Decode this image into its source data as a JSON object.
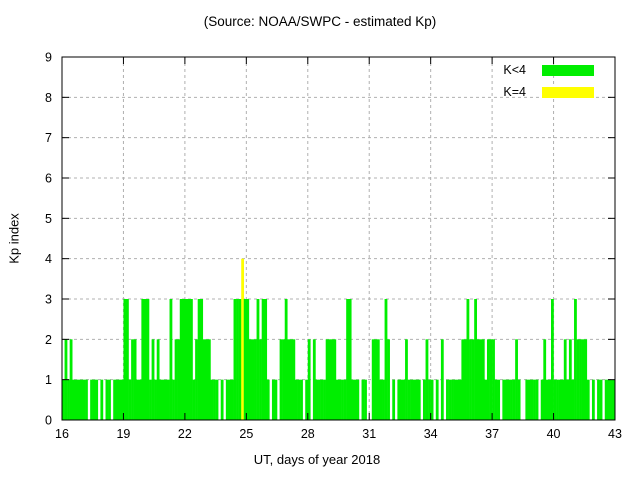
{
  "title": "(Source: NOAA/SWPC - estimated Kp)",
  "x_axis": {
    "label": "UT, days of year 2018",
    "range": [
      16,
      43
    ]
  },
  "y_axis": {
    "label": "Kp index",
    "range": [
      0,
      9
    ]
  },
  "legend": {
    "items": [
      {
        "label": "K<4",
        "color": "#00ee00"
      },
      {
        "label": "K=4",
        "color": "#ffff00"
      }
    ]
  },
  "colors": {
    "green_bar": "#00ee00",
    "yellow_bar": "#ffff00",
    "grid": "#b0b0b0",
    "axis": "#000000",
    "background": "#ffffff"
  },
  "chart_data": {
    "type": "bar",
    "title": "(Source: NOAA/SWPC - estimated Kp)",
    "xlabel": "UT, days of year 2018",
    "ylabel": "Kp index",
    "xlim": [
      16,
      43
    ],
    "ylim": [
      0,
      9
    ],
    "x_ticks": [
      16,
      19,
      22,
      25,
      28,
      31,
      34,
      37,
      40,
      43
    ],
    "y_ticks": [
      0,
      1,
      2,
      3,
      4,
      5,
      6,
      7,
      8,
      9
    ],
    "grid": true,
    "legend_position": "top-right",
    "samples_per_day": 8,
    "series": [
      {
        "name": "K<4",
        "color": "#00ee00",
        "rule": "kp<4"
      },
      {
        "name": "K=4",
        "color": "#ffff00",
        "rule": "kp=4"
      }
    ],
    "days": [
      {
        "day": 16,
        "kp": [
          1,
          2,
          1,
          2,
          1,
          1,
          1,
          1
        ]
      },
      {
        "day": 17,
        "kp": [
          1,
          1,
          0,
          1,
          1,
          1,
          0,
          1
        ]
      },
      {
        "day": 18,
        "kp": [
          0,
          1,
          1,
          0,
          1,
          1,
          1,
          1
        ]
      },
      {
        "day": 19,
        "kp": [
          3,
          3,
          1,
          2,
          2,
          1,
          1,
          3
        ]
      },
      {
        "day": 20,
        "kp": [
          3,
          3,
          1,
          2,
          1,
          2,
          1,
          1
        ]
      },
      {
        "day": 21,
        "kp": [
          1,
          1,
          3,
          1,
          2,
          2,
          3,
          3
        ]
      },
      {
        "day": 22,
        "kp": [
          3,
          3,
          3,
          1,
          2,
          3,
          3,
          2
        ]
      },
      {
        "day": 23,
        "kp": [
          2,
          2,
          1,
          1,
          1,
          0,
          1,
          0
        ]
      },
      {
        "day": 24,
        "kp": [
          1,
          1,
          1,
          3,
          3,
          3,
          4,
          3
        ]
      },
      {
        "day": 25,
        "kp": [
          3,
          2,
          2,
          2,
          3,
          2,
          3,
          3
        ]
      },
      {
        "day": 26,
        "kp": [
          1,
          0,
          1,
          1,
          0,
          2,
          2,
          3
        ]
      },
      {
        "day": 27,
        "kp": [
          2,
          2,
          2,
          1,
          1,
          1,
          0,
          1
        ]
      },
      {
        "day": 28,
        "kp": [
          2,
          0,
          2,
          1,
          1,
          1,
          1,
          2
        ]
      },
      {
        "day": 29,
        "kp": [
          2,
          2,
          2,
          1,
          1,
          1,
          1,
          3
        ]
      },
      {
        "day": 30,
        "kp": [
          3,
          1,
          1,
          1,
          0,
          1,
          1,
          0
        ]
      },
      {
        "day": 31,
        "kp": [
          0,
          2,
          2,
          2,
          1,
          1,
          3,
          2
        ]
      },
      {
        "day": 32,
        "kp": [
          0,
          1,
          0,
          1,
          1,
          1,
          2,
          1
        ]
      },
      {
        "day": 33,
        "kp": [
          1,
          1,
          1,
          1,
          0,
          1,
          2,
          1
        ]
      },
      {
        "day": 34,
        "kp": [
          1,
          0,
          1,
          0,
          2,
          0,
          1,
          1
        ]
      },
      {
        "day": 35,
        "kp": [
          1,
          1,
          1,
          1,
          2,
          2,
          3,
          2
        ]
      },
      {
        "day": 36,
        "kp": [
          2,
          3,
          2,
          2,
          2,
          1,
          2,
          2
        ]
      },
      {
        "day": 37,
        "kp": [
          2,
          1,
          1,
          0,
          1,
          1,
          1,
          1
        ]
      },
      {
        "day": 38,
        "kp": [
          1,
          2,
          1,
          0,
          0,
          1,
          1,
          1
        ]
      },
      {
        "day": 39,
        "kp": [
          1,
          1,
          0,
          1,
          2,
          1,
          1,
          3
        ]
      },
      {
        "day": 40,
        "kp": [
          1,
          1,
          1,
          1,
          2,
          1,
          2,
          1
        ]
      },
      {
        "day": 41,
        "kp": [
          3,
          2,
          2,
          2,
          2,
          1,
          0,
          1
        ]
      },
      {
        "day": 42,
        "kp": [
          0,
          1,
          1,
          0,
          1,
          1,
          1,
          1
        ]
      }
    ]
  }
}
